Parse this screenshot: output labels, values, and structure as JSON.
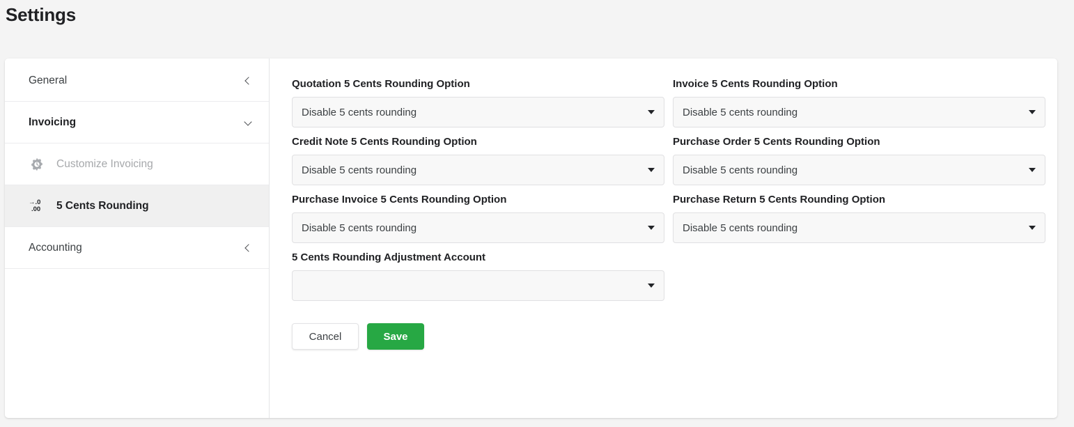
{
  "header": {
    "title": "Settings"
  },
  "sidebar": {
    "items": [
      {
        "label": "General",
        "icon": "chevron-left-icon",
        "state": "collapsed",
        "level": "top"
      },
      {
        "label": "Invoicing",
        "icon": "chevron-down-icon",
        "state": "expanded",
        "level": "top"
      },
      {
        "label": "Customize Invoicing",
        "icon": "gear-clock-icon",
        "state": "disabled",
        "level": "sub"
      },
      {
        "label": "5 Cents Rounding",
        "icon": "decimal-round-icon",
        "state": "selected",
        "level": "sub"
      },
      {
        "label": "Accounting",
        "icon": "chevron-left-icon",
        "state": "collapsed",
        "level": "top"
      }
    ],
    "round_icon": {
      "line1": "→.0",
      "line2": ".00"
    }
  },
  "main": {
    "fields": [
      {
        "label": "Quotation 5 Cents Rounding Option",
        "value": "Disable 5 cents rounding"
      },
      {
        "label": "Invoice 5 Cents Rounding Option",
        "value": "Disable 5 cents rounding"
      },
      {
        "label": "Credit Note 5 Cents Rounding Option",
        "value": "Disable 5 cents rounding"
      },
      {
        "label": "Purchase Order 5 Cents Rounding Option",
        "value": "Disable 5 cents rounding"
      },
      {
        "label": "Purchase Invoice 5 Cents Rounding Option",
        "value": "Disable 5 cents rounding"
      },
      {
        "label": "Purchase Return 5 Cents Rounding Option",
        "value": "Disable 5 cents rounding"
      },
      {
        "label": "5 Cents Rounding Adjustment Account",
        "value": ""
      }
    ],
    "buttons": {
      "cancel": "Cancel",
      "save": "Save"
    }
  },
  "colors": {
    "save_green": "#27a844",
    "page_bg": "#f4f4f4",
    "card_bg": "#ffffff",
    "selected_row": "#f0f0f0",
    "field_bg": "#f8f8f8"
  }
}
